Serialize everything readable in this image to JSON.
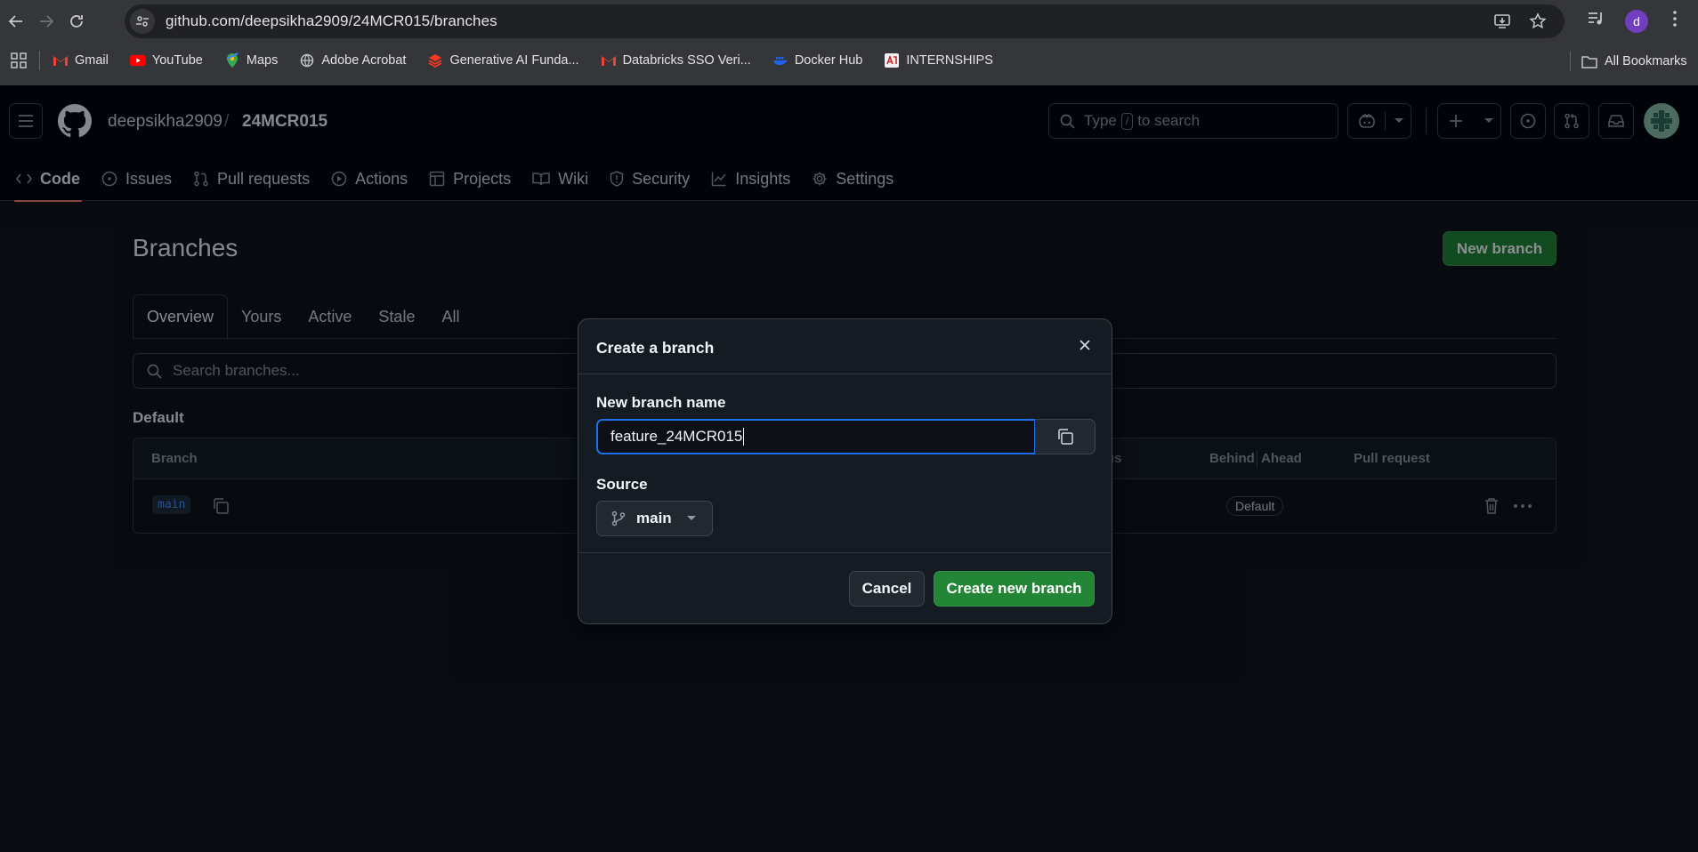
{
  "browser": {
    "url": "github.com/deepsikha2909/24MCR015/branches",
    "profile_initial": "d",
    "bookmarks": [
      {
        "label": "Gmail",
        "icon": "gmail-icon"
      },
      {
        "label": "YouTube",
        "icon": "youtube-icon"
      },
      {
        "label": "Maps",
        "icon": "maps-icon"
      },
      {
        "label": "Adobe Acrobat",
        "icon": "globe-icon"
      },
      {
        "label": "Generative AI Funda...",
        "icon": "databricks-icon"
      },
      {
        "label": "Databricks SSO Veri...",
        "icon": "gmail-icon"
      },
      {
        "label": "Docker Hub",
        "icon": "docker-icon"
      },
      {
        "label": "INTERNSHIPS",
        "icon": "internships-icon"
      }
    ],
    "all_bookmarks": "All Bookmarks"
  },
  "header": {
    "owner": "deepsikha2909",
    "separator": "/",
    "repo": "24MCR015",
    "search_before": "Type",
    "search_key": "/",
    "search_after": "to search"
  },
  "repo_tabs": [
    {
      "label": "Code",
      "icon": "code-icon"
    },
    {
      "label": "Issues",
      "icon": "issue-icon"
    },
    {
      "label": "Pull requests",
      "icon": "pull-request-icon"
    },
    {
      "label": "Actions",
      "icon": "play-icon"
    },
    {
      "label": "Projects",
      "icon": "table-icon"
    },
    {
      "label": "Wiki",
      "icon": "book-icon"
    },
    {
      "label": "Security",
      "icon": "shield-icon"
    },
    {
      "label": "Insights",
      "icon": "graph-icon"
    },
    {
      "label": "Settings",
      "icon": "gear-icon"
    }
  ],
  "page": {
    "title": "Branches",
    "new_branch_label": "New branch",
    "subtabs": [
      "Overview",
      "Yours",
      "Active",
      "Stale",
      "All"
    ],
    "search_placeholder": "Search branches...",
    "section_label": "Default",
    "table_headers": {
      "branch": "Branch",
      "status": "us",
      "behind": "Behind",
      "ahead": "Ahead",
      "pull_request": "Pull request"
    },
    "row": {
      "branch": "main",
      "badge": "Default"
    }
  },
  "modal": {
    "title": "Create a branch",
    "name_label": "New branch name",
    "name_value": "feature_24MCR015",
    "source_label": "Source",
    "source_value": "main",
    "cancel_label": "Cancel",
    "submit_label": "Create new branch"
  },
  "colors": {
    "accent_green": "#238636",
    "focus_blue": "#1f6feb",
    "tab_underline": "#f78166",
    "branch_chip": "#4493f8"
  }
}
